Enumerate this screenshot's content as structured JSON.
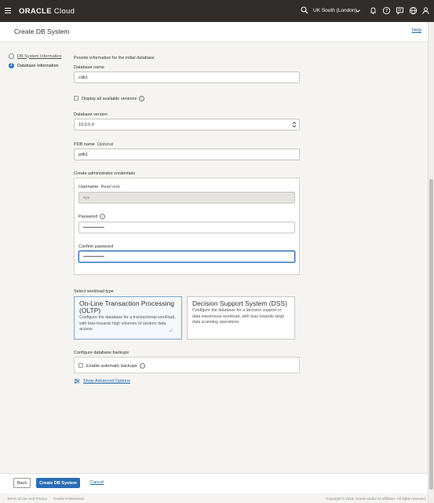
{
  "topbar": {
    "brand_bold": "ORACLE",
    "brand_light": "Cloud",
    "region": "UK South (London)",
    "icons": [
      "menu-icon",
      "search-icon",
      "chevron-down-icon",
      "bell-icon",
      "help-icon",
      "chat-icon",
      "globe-icon",
      "user-icon"
    ]
  },
  "header": {
    "title": "Create DB System",
    "help": "Help"
  },
  "steps": [
    {
      "number": "",
      "label": "DB System Information",
      "state": "done"
    },
    {
      "number": "2",
      "label": "Database Information",
      "state": "active"
    }
  ],
  "form": {
    "intro": "Provide information for the initial database",
    "db_name_label": "Database name",
    "db_name_value": "cdb1",
    "all_versions_label": "Display all available versions",
    "db_version_label": "Database version",
    "db_version_value": "19.0.0.0",
    "pdb_label": "PDB name",
    "pdb_optional": "Optional",
    "pdb_value": "pdb1",
    "creds_heading": "Create administrator credentials",
    "username_label": "Username",
    "username_readonly": "Read only",
    "username_value": "sys",
    "password_label": "Password",
    "password_value": "••••••••••••••",
    "confirm_label": "Confirm password",
    "confirm_value": "••••••••••••••",
    "workload_heading": "Select workload type",
    "workloads": [
      {
        "title": "On-Line Transaction Processing (OLTP)",
        "desc": "Configure the database for a transactional workload, with bias towards high volumes of random data access.",
        "selected": true
      },
      {
        "title": "Decision Support System (DSS)",
        "desc": "Configure the database for a decision support or data warehouse workload, with bias towards large data scanning operations.",
        "selected": false
      }
    ],
    "backups_heading": "Configure database backups",
    "auto_backups_label": "Enable automatic backups",
    "advanced_link": "Show Advanced Options"
  },
  "footer": {
    "back": "Back",
    "create": "Create DB System",
    "cancel": "Cancel"
  },
  "legal": {
    "terms": "Terms of Use and Privacy",
    "cookies": "Cookie Preferences",
    "copyright": "Copyright © 2019, Oracle and/or its affiliates. All rights reserved."
  },
  "colors": {
    "topbar": "#312d2a",
    "primary": "#2a6db5",
    "link": "#1c65a8"
  }
}
